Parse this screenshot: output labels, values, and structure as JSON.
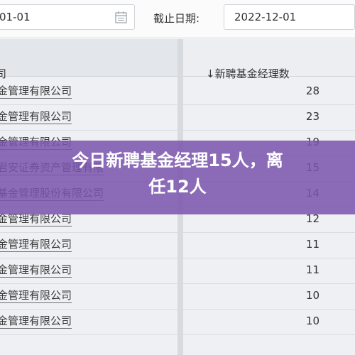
{
  "filters": {
    "start_date": "01-01",
    "end_label": "截止日期:",
    "end_date": "2022-12-01"
  },
  "table": {
    "col1_header": "司",
    "col2_header": "↓新聘基金经理数",
    "rows": [
      {
        "name": "金管理有限公司",
        "count": "28"
      },
      {
        "name": "金管理有限公司",
        "count": "23"
      },
      {
        "name": "金管理有限公司",
        "count": "19"
      },
      {
        "name": "君安证券资产管理有限",
        "count": "15"
      },
      {
        "name": "基金管理股份有限公司",
        "count": "14"
      },
      {
        "name": "金管理有限公司",
        "count": "12"
      },
      {
        "name": "金管理有限公司",
        "count": "11"
      },
      {
        "name": "金管理有限公司",
        "count": "11"
      },
      {
        "name": "金管理有限公司",
        "count": "10"
      },
      {
        "name": "金管理有限公司",
        "count": "10"
      }
    ]
  },
  "banner": {
    "line1": "今日新聘基金经理15人，离",
    "line2": "任12人"
  }
}
